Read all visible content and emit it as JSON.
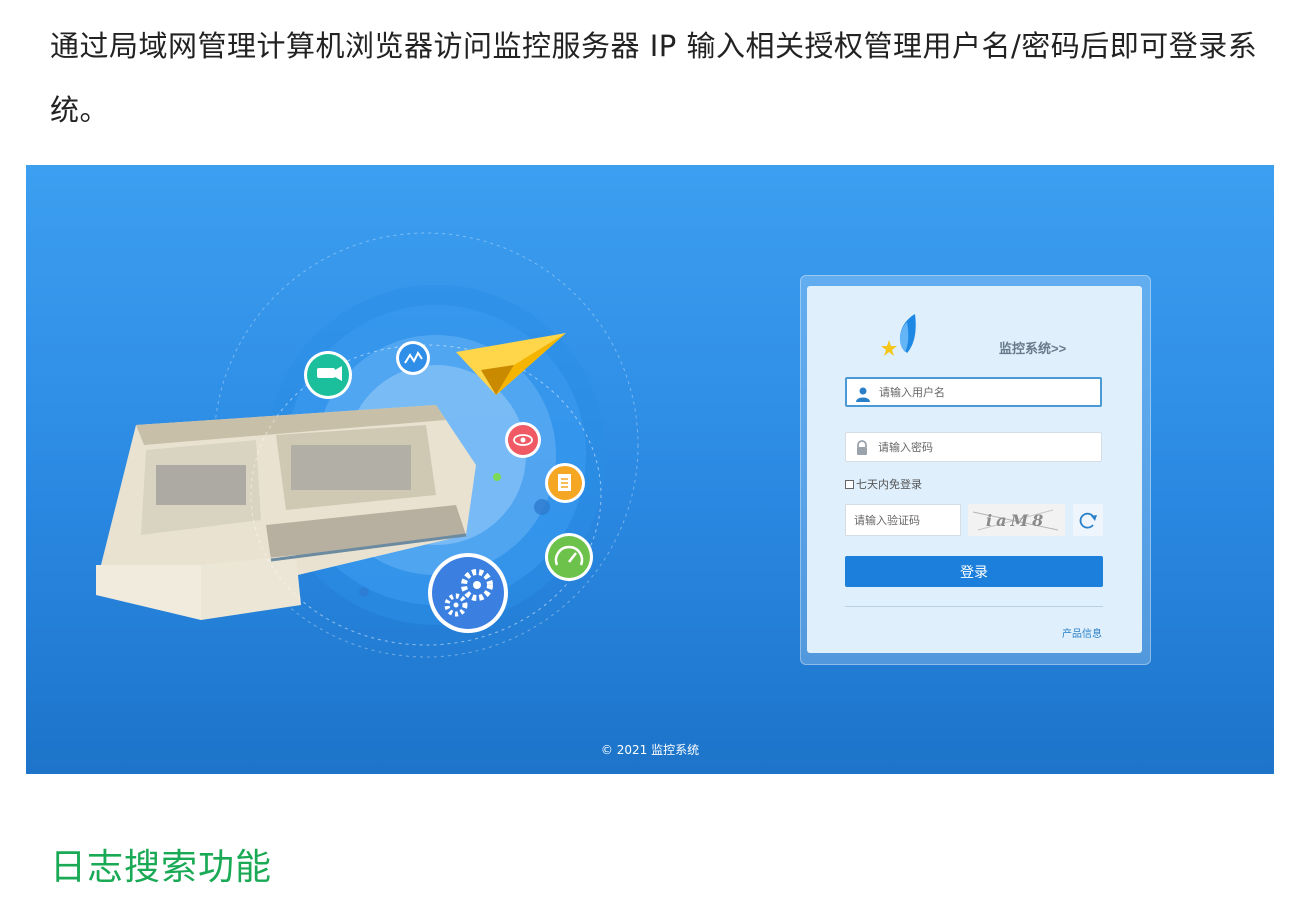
{
  "article": {
    "intro_text": "通过局域网管理计算机浏览器访问监控服务器 IP 输入相关授权管理用户名/密码后即可登录系统。",
    "section_heading": "日志搜索功能"
  },
  "login_page": {
    "system_title": "监控系统>>",
    "username": {
      "placeholder": "请输入用户名",
      "value": ""
    },
    "password": {
      "placeholder": "请输入密码",
      "value": ""
    },
    "remember_label": "七天内免登录",
    "remember_checked": false,
    "captcha": {
      "placeholder": "请输入验证码",
      "value": "",
      "image_text": "iaM8"
    },
    "login_button": "登录",
    "product_info_link": "产品信息",
    "copyright": "© 2021  监控系统"
  },
  "icons": {
    "user": "user-icon",
    "lock": "lock-icon",
    "refresh": "refresh-icon",
    "camera": "camera-icon",
    "chart": "chart-icon",
    "eye": "eye-icon",
    "document": "document-icon",
    "gauge": "gauge-icon",
    "gears": "gears-icon",
    "paper_plane": "paper-plane-icon",
    "logo": "leaf-star-logo"
  },
  "colors": {
    "heading_green": "#1aaa55",
    "login_button": "#1c7fdc",
    "background_top": "#3d9ff0",
    "background_bottom": "#1d74c9",
    "link_blue": "#2a7fc8"
  }
}
